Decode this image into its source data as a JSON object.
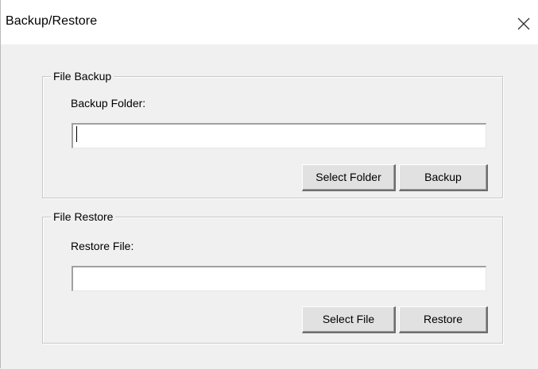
{
  "window": {
    "title": "Backup/Restore",
    "close_icon": "close-icon"
  },
  "backup": {
    "group_label": "File Backup",
    "field_label": "Backup Folder:",
    "field_value": "",
    "select_button": "Select Folder",
    "action_button": "Backup"
  },
  "restore": {
    "group_label": "File Restore",
    "field_label": "Restore File:",
    "field_value": "",
    "select_button": "Select File",
    "action_button": "Restore"
  }
}
